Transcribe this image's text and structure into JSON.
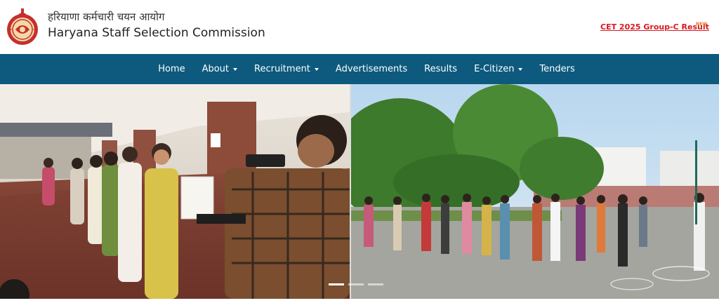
{
  "header": {
    "title_hindi": "हरियाणा कर्मचारी चयन आयोग",
    "title_english": "Haryana Staff Selection Commission",
    "result_link": "CET 2025 Group-C Result",
    "new_badge": "NEW",
    "logo_icon": "haryana-emblem-icon"
  },
  "nav": {
    "items": [
      {
        "label": "Home",
        "dropdown": false
      },
      {
        "label": "About",
        "dropdown": true
      },
      {
        "label": "Recruitment",
        "dropdown": true
      },
      {
        "label": "Advertisements",
        "dropdown": false
      },
      {
        "label": "Results",
        "dropdown": false
      },
      {
        "label": "E-Citizen",
        "dropdown": true
      },
      {
        "label": "Tenders",
        "dropdown": false
      }
    ]
  },
  "carousel": {
    "slide_count": 3,
    "active_index": 0
  },
  "colors": {
    "navbar": "#0d5a7e",
    "result_link": "#d9191f",
    "new_badge": "#e8731a"
  }
}
